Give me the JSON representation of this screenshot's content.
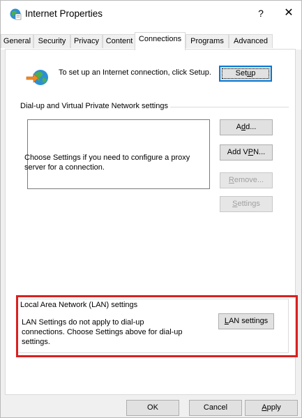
{
  "window": {
    "title": "Internet Properties",
    "help_label": "?",
    "close_label": "✕"
  },
  "tabs": [
    {
      "label": "General"
    },
    {
      "label": "Security"
    },
    {
      "label": "Privacy"
    },
    {
      "label": "Content"
    },
    {
      "label": "Connections"
    },
    {
      "label": "Programs"
    },
    {
      "label": "Advanced"
    }
  ],
  "active_tab": "Connections",
  "setup": {
    "description": "To set up an Internet connection, click Setup.",
    "button": {
      "before": "Set",
      "mnemonic": "u",
      "after": "p"
    }
  },
  "dialup": {
    "group_label": "Dial-up and Virtual Private Network settings",
    "add_button": {
      "before": "A",
      "mnemonic": "d",
      "after": "d..."
    },
    "add_vpn_button": {
      "before": "Add V",
      "mnemonic": "P",
      "after": "N..."
    },
    "remove_button": {
      "before": "",
      "mnemonic": "R",
      "after": "emove..."
    },
    "settings_button": {
      "before": "",
      "mnemonic": "S",
      "after": "ettings"
    },
    "proxy_hint": "Choose Settings if you need to configure a proxy server for a connection."
  },
  "lan": {
    "group_label": "Local Area Network (LAN) settings",
    "description": "LAN Settings do not apply to dial-up connections. Choose Settings above for dial-up settings.",
    "button": {
      "before": "",
      "mnemonic": "L",
      "after": "AN settings"
    }
  },
  "footer": {
    "ok_label": "OK",
    "cancel_label": "Cancel",
    "apply_button": {
      "before": "",
      "mnemonic": "A",
      "after": "pply"
    }
  },
  "colors": {
    "highlight": "#d9201f",
    "default_button_border": "#0078d7"
  }
}
